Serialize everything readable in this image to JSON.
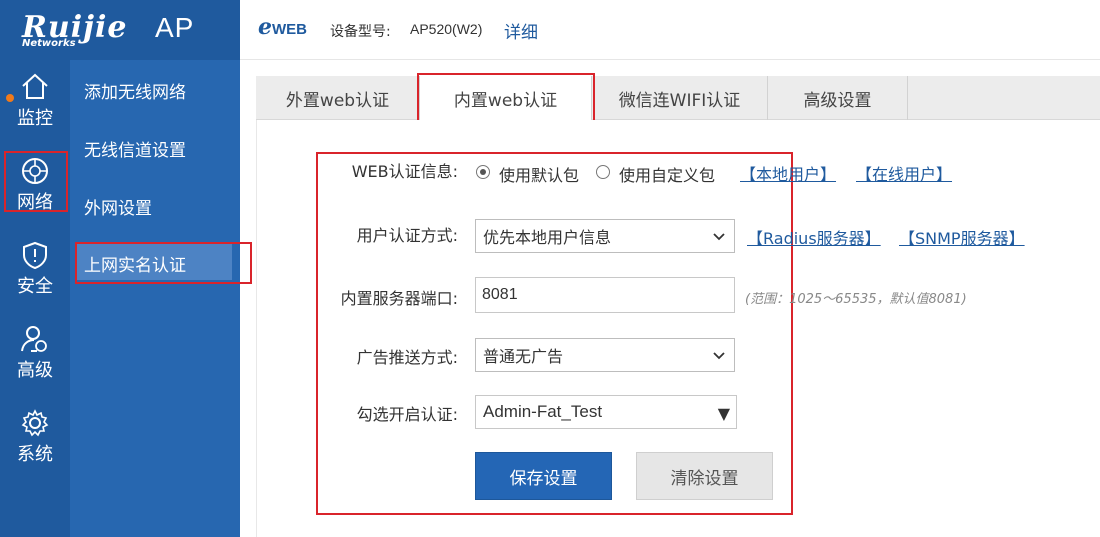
{
  "brand": {
    "logo": "Ruijie",
    "logo_sub": "Networks",
    "product": "AP"
  },
  "header": {
    "eweb_e": "e",
    "eweb_rest": "WEB",
    "model_label": "设备型号:",
    "model_value": "AP520(W2)",
    "detail_link": "详细"
  },
  "rail": {
    "items": [
      {
        "label": "监控",
        "icon": "home-icon"
      },
      {
        "label": "网络",
        "icon": "network-icon"
      },
      {
        "label": "安全",
        "icon": "shield-icon"
      },
      {
        "label": "高级",
        "icon": "user-settings-icon"
      },
      {
        "label": "系统",
        "icon": "gear-icon"
      }
    ]
  },
  "submenu": {
    "items": [
      {
        "label": "添加无线网络"
      },
      {
        "label": "无线信道设置"
      },
      {
        "label": "外网设置"
      },
      {
        "label": "上网实名认证"
      }
    ]
  },
  "tabs": [
    {
      "label": "外置web认证"
    },
    {
      "label": "内置web认证"
    },
    {
      "label": "微信连WIFI认证"
    },
    {
      "label": "高级设置"
    }
  ],
  "form": {
    "web_auth_label": "WEB认证信息:",
    "radio_default": "使用默认包",
    "radio_custom": "使用自定义包",
    "link_local_users": "【本地用户】",
    "link_online_users": "【在线用户】",
    "auth_method_label": "用户认证方式:",
    "auth_method_value": "优先本地用户信息",
    "link_radius": "【Radius服务器】",
    "link_snmp": "【SNMP服务器】",
    "port_label": "内置服务器端口:",
    "port_value": "8081",
    "port_hint": "(范围：1025～65535，默认值8081)",
    "ad_label": "广告推送方式:",
    "ad_value": "普通无广告",
    "ssid_label": "勾选开启认证:",
    "ssid_value": "Admin-Fat_Test",
    "save_button": "保存设置",
    "clear_button": "清除设置"
  },
  "colors": {
    "brand_blue": "#1f5a9e",
    "submenu_blue": "#2767b0",
    "highlight_red": "#d9242b",
    "notify_orange": "#f07a1b"
  }
}
